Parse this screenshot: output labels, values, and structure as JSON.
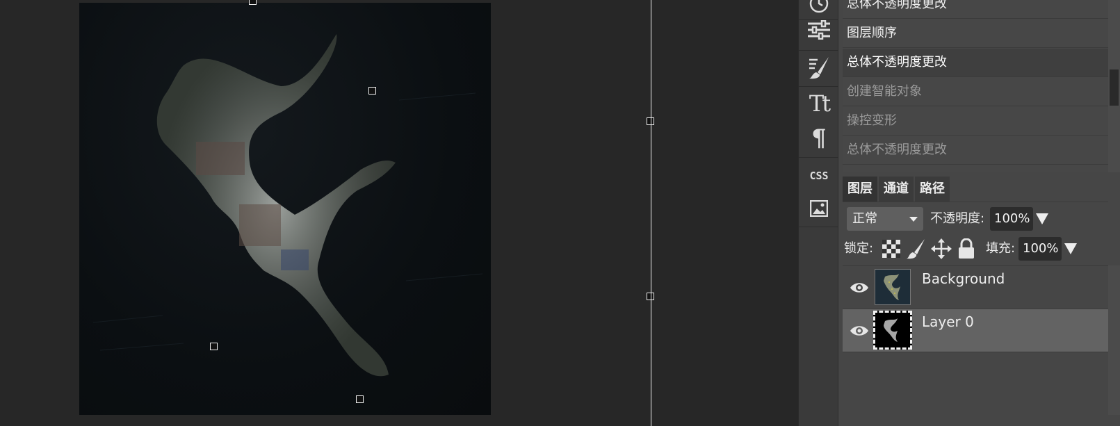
{
  "history": {
    "items": [
      {
        "label": "总体不透明度更改",
        "state": "active"
      },
      {
        "label": "图层顺序",
        "state": "active"
      },
      {
        "label": "总体不透明度更改",
        "state": "current"
      },
      {
        "label": "创建智能对象",
        "state": "undone"
      },
      {
        "label": "操控变形",
        "state": "undone"
      },
      {
        "label": "总体不透明度更改",
        "state": "undone"
      }
    ]
  },
  "tools": {
    "items": [
      {
        "name": "history-icon"
      },
      {
        "name": "adjustments-icon"
      },
      {
        "name": "brush-settings-icon"
      },
      {
        "name": "character-icon",
        "glyph": "Tt"
      },
      {
        "name": "paragraph-icon",
        "glyph": "¶"
      },
      {
        "name": "css-icon",
        "glyph": "CSS"
      },
      {
        "name": "image-icon"
      }
    ]
  },
  "layers_panel": {
    "tabs": [
      "图层",
      "通道",
      "路径"
    ],
    "blend_mode": "正常",
    "opacity_label": "不透明度:",
    "opacity_value": "100%",
    "lock_label": "锁定:",
    "fill_label": "填充:",
    "fill_value": "100%",
    "layers": [
      {
        "name": "Background",
        "visible": true,
        "selected": false
      },
      {
        "name": "Layer 0",
        "visible": true,
        "selected": true
      }
    ]
  },
  "colors": {
    "panel_bg": "#464646",
    "selected_row": "#636363",
    "canvas_bg": "#272727"
  }
}
